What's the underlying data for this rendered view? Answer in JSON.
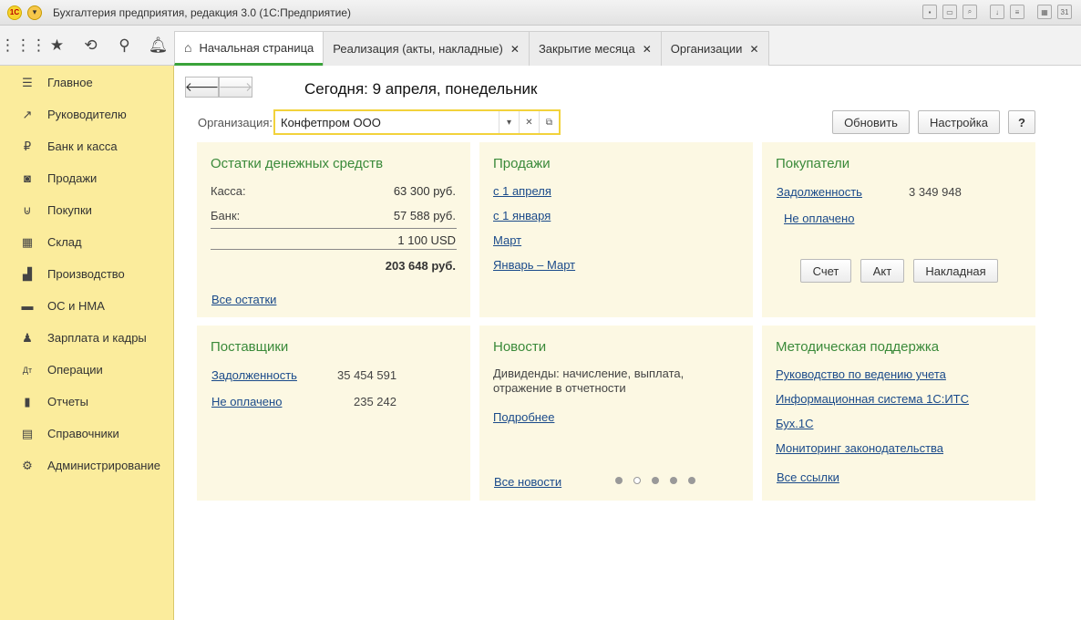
{
  "window": {
    "title": "Бухгалтерия предприятия, редакция 3.0  (1С:Предприятие)",
    "logo": "1С"
  },
  "tabs": [
    {
      "label": "Начальная страница",
      "closable": false,
      "active": true
    },
    {
      "label": "Реализация (акты, накладные)",
      "closable": true,
      "active": false
    },
    {
      "label": "Закрытие месяца",
      "closable": true,
      "active": false
    },
    {
      "label": "Организации",
      "closable": true,
      "active": false
    }
  ],
  "sidebar": {
    "items": [
      {
        "label": "Главное",
        "icon": "menu-icon"
      },
      {
        "label": "Руководителю",
        "icon": "trend-icon"
      },
      {
        "label": "Банк и касса",
        "icon": "ruble-icon"
      },
      {
        "label": "Продажи",
        "icon": "bag-icon"
      },
      {
        "label": "Покупки",
        "icon": "cart-icon"
      },
      {
        "label": "Склад",
        "icon": "grid-icon"
      },
      {
        "label": "Производство",
        "icon": "factory-icon"
      },
      {
        "label": "ОС и НМА",
        "icon": "truck-icon"
      },
      {
        "label": "Зарплата и кадры",
        "icon": "person-icon"
      },
      {
        "label": "Операции",
        "icon": "dt-kt-icon"
      },
      {
        "label": "Отчеты",
        "icon": "bar-chart-icon"
      },
      {
        "label": "Справочники",
        "icon": "book-icon"
      },
      {
        "label": "Администрирование",
        "icon": "gear-icon"
      }
    ]
  },
  "main": {
    "today": "Сегодня: 9 апреля, понедельник",
    "org_label": "Организация:",
    "org_value": "Конфетпром ООО",
    "buttons": {
      "refresh": "Обновить",
      "settings": "Настройка",
      "help": "?"
    }
  },
  "panels": {
    "cash": {
      "title": "Остатки денежных средств",
      "rows": [
        {
          "label": "Касса:",
          "value": "63 300 руб."
        },
        {
          "label": "Банк:",
          "value": "57 588 руб."
        }
      ],
      "usd": "1 100 USD",
      "total": "203 648 руб.",
      "link": "Все остатки"
    },
    "sales": {
      "title": "Продажи",
      "links": [
        "с 1 апреля",
        "с 1 января",
        "Март",
        "Январь – Март"
      ]
    },
    "buyers": {
      "title": "Покупатели",
      "debt_label": "Задолженность",
      "debt_value": "3 349 948",
      "unpaid": "Не оплачено",
      "buttons": [
        "Счет",
        "Акт",
        "Накладная"
      ]
    },
    "suppliers": {
      "title": "Поставщики",
      "debt_label": "Задолженность",
      "debt_value": "35 454 591",
      "unpaid_label": "Не оплачено",
      "unpaid_value": "235 242"
    },
    "news": {
      "title": "Новости",
      "text_line1": "Дивиденды: начисление, выплата,",
      "text_line2": "отражение в отчетности",
      "more": "Подробнее",
      "all": "Все новости",
      "page_count": 5,
      "current_page": 2
    },
    "support": {
      "title": "Методическая поддержка",
      "links": [
        "Руководство по ведению учета",
        "Информационная система 1С:ИТС",
        "Бух.1С",
        "Мониторинг законодательства"
      ],
      "all": "Все ссылки"
    }
  }
}
